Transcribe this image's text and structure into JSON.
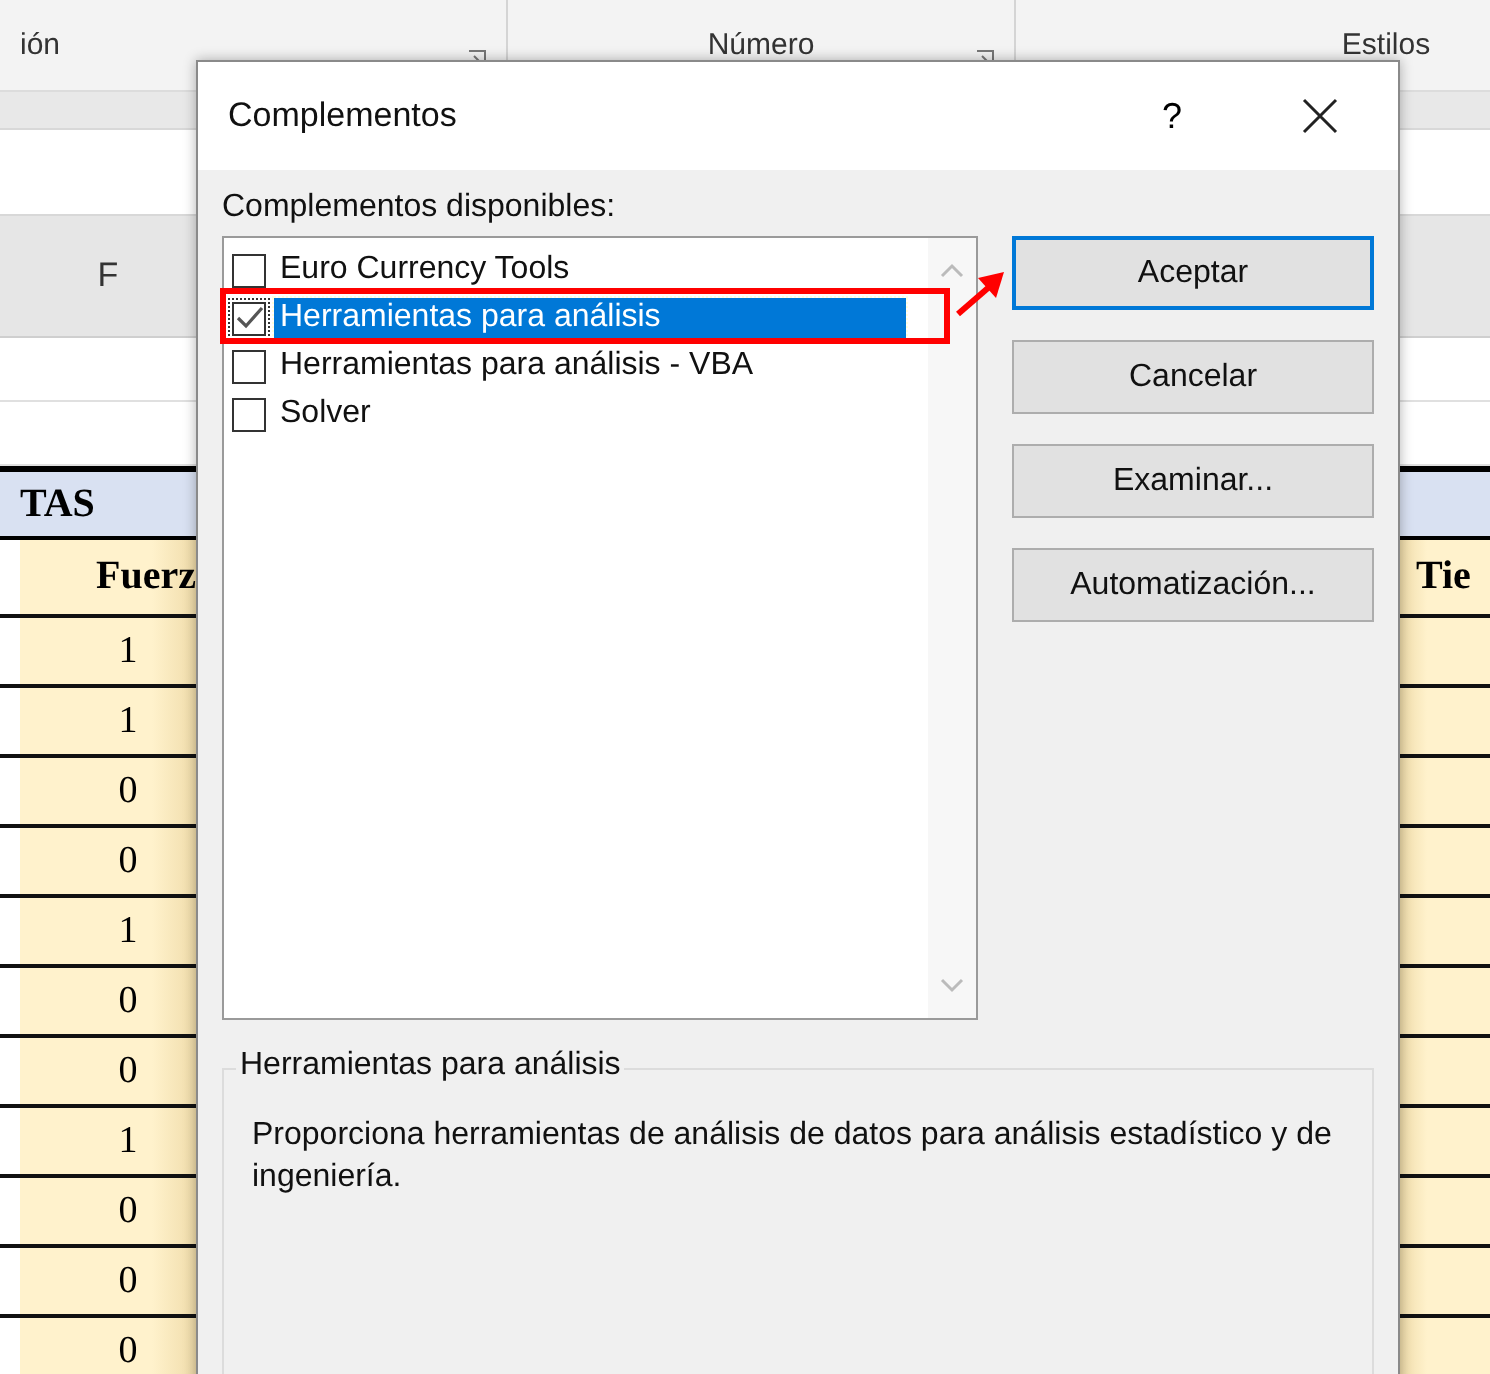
{
  "ribbon": {
    "groups": [
      {
        "label": "ión"
      },
      {
        "label": "Número"
      },
      {
        "label": "Estilos"
      }
    ]
  },
  "sheet": {
    "column_header": "F",
    "title": "TAS",
    "headers": [
      "Fuerz",
      "Tie"
    ],
    "values": [
      "1",
      "1",
      "0",
      "0",
      "1",
      "0",
      "0",
      "1",
      "0",
      "0",
      "0"
    ]
  },
  "dialog": {
    "title": "Complementos",
    "help": "?",
    "list_label": "Complementos disponibles:",
    "items": [
      {
        "label": "Euro Currency Tools",
        "checked": false,
        "selected": false
      },
      {
        "label": "Herramientas para análisis",
        "checked": true,
        "selected": true
      },
      {
        "label": "Herramientas para análisis - VBA",
        "checked": false,
        "selected": false
      },
      {
        "label": "Solver",
        "checked": false,
        "selected": false
      }
    ],
    "buttons": [
      {
        "label": "Aceptar",
        "default": true
      },
      {
        "label": "Cancelar",
        "default": false
      },
      {
        "label": "Examinar...",
        "default": false
      },
      {
        "label": "Automatización...",
        "default": false
      }
    ],
    "description": {
      "title": "Herramientas para análisis",
      "text": "Proporciona herramientas de análisis de datos para análisis estadístico y de ingeniería."
    }
  }
}
